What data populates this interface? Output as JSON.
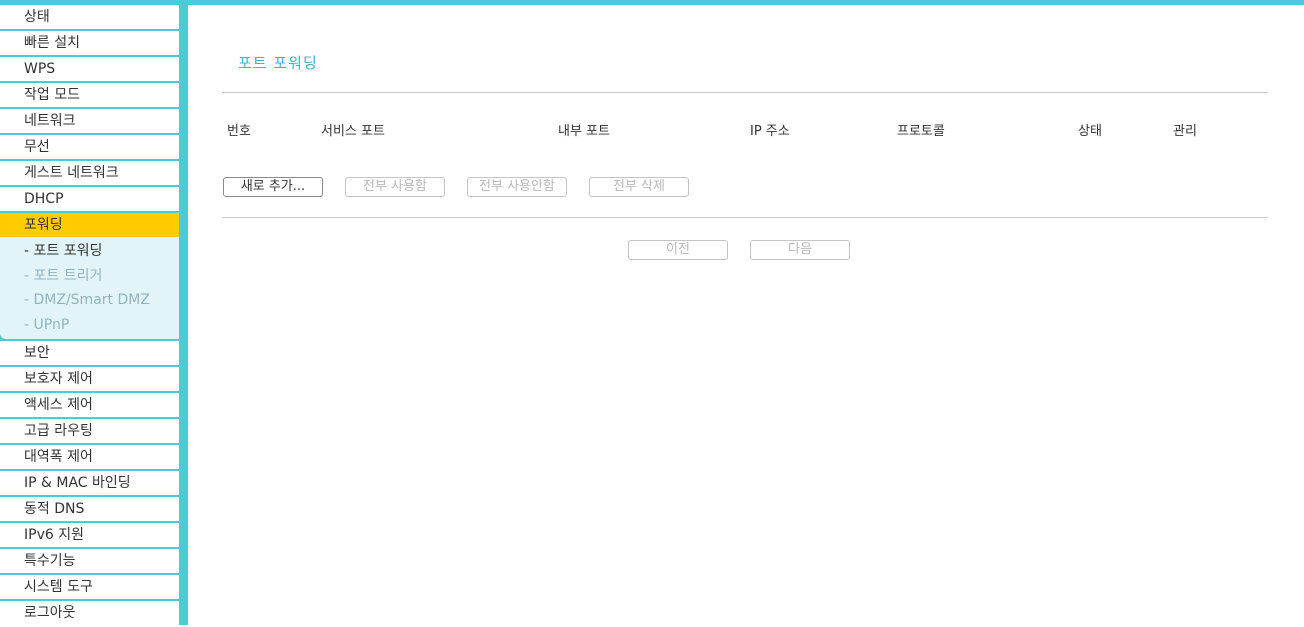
{
  "colors": {
    "accent": "#4acbd6",
    "active_menu": "#ffcc00",
    "submenu_bg": "#e2f4f7",
    "title": "#3ab8c8"
  },
  "sidebar": {
    "items_before": [
      {
        "label": "상태"
      },
      {
        "label": "빠른 설치"
      },
      {
        "label": "WPS"
      },
      {
        "label": "작업 모드"
      },
      {
        "label": "네트워크"
      },
      {
        "label": "무선"
      },
      {
        "label": "게스트 네트워크"
      },
      {
        "label": "DHCP"
      }
    ],
    "active": {
      "label": "포워딩",
      "subitems": [
        {
          "label": "- 포트 포워딩"
        },
        {
          "label": "- 포트 트리거"
        },
        {
          "label": "- DMZ/Smart DMZ"
        },
        {
          "label": "- UPnP"
        }
      ]
    },
    "items_after": [
      {
        "label": "보안"
      },
      {
        "label": "보호자 제어"
      },
      {
        "label": "액세스 제어"
      },
      {
        "label": "고급 라우팅"
      },
      {
        "label": "대역폭 제어"
      },
      {
        "label": "IP & MAC 바인딩"
      },
      {
        "label": "동적 DNS"
      },
      {
        "label": "IPv6 지원"
      },
      {
        "label": "특수기능"
      },
      {
        "label": "시스템 도구"
      },
      {
        "label": "로그아웃"
      }
    ]
  },
  "main": {
    "title": "포트 포워딩",
    "columns": [
      "번호",
      "서비스 포트",
      "내부 포트",
      "IP 주소",
      "프로토콜",
      "상태",
      "관리"
    ],
    "actions": {
      "add": "새로 추가...",
      "enable_all": "전부 사용함",
      "disable_all": "전부 사용안함",
      "delete_all": "전부 삭제"
    },
    "pagination": {
      "prev": "이전",
      "next": "다음"
    }
  }
}
